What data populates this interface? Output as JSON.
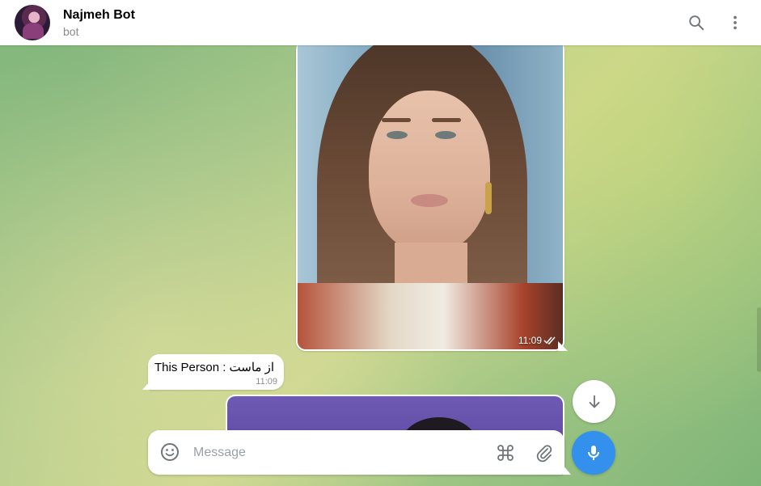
{
  "header": {
    "title": "Najmeh Bot",
    "subtitle": "bot",
    "avatar_icon": "user-photo-avatar",
    "search_icon": "search-icon",
    "more_icon": "more-vertical-icon"
  },
  "messages": [
    {
      "type": "photo",
      "direction": "outgoing",
      "time": "11:09",
      "status": "read-double-check"
    },
    {
      "type": "text",
      "direction": "incoming",
      "text": "از ماست : This Person",
      "time": "11:09"
    },
    {
      "type": "photo",
      "direction": "outgoing",
      "partial": true
    }
  ],
  "composer": {
    "placeholder": "Message",
    "emoji_icon": "emoji-smile-icon",
    "commands_icon": "command-icon",
    "attach_icon": "paperclip-icon",
    "mic_icon": "microphone-icon"
  },
  "scroll_down_icon": "arrow-down-icon",
  "colors": {
    "accent": "#3390ec",
    "header_bg": "#ffffff",
    "bubble_bg": "#ffffff",
    "subtitle": "#8a8a8a"
  }
}
